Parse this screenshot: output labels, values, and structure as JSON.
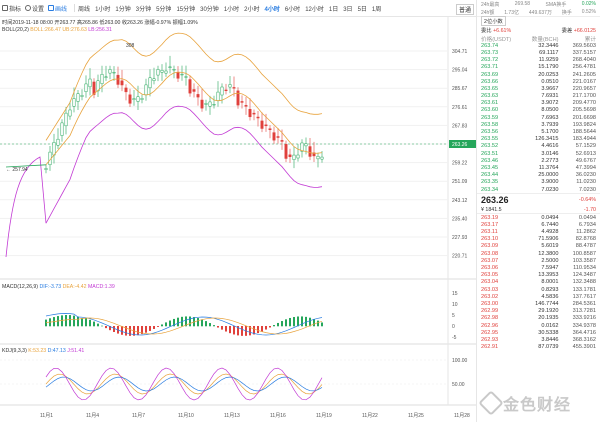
{
  "toolbar": {
    "items": [
      {
        "label": "指标",
        "icon": "indicator-icon"
      },
      {
        "label": "设置",
        "icon": "settings-icon"
      },
      {
        "label": "画线",
        "icon": "draw-line-icon",
        "active": true
      }
    ],
    "periods": [
      "周线",
      "1小时",
      "1分钟",
      "3分钟",
      "5分钟",
      "15分钟",
      "30分钟",
      "1小时",
      "2小时",
      "4小时",
      "6小时",
      "12小时",
      "1日",
      "3日",
      "5日",
      "1周"
    ],
    "active_period_index": 9,
    "right_select": "普通",
    "right_select2": "原生"
  },
  "info_line": {
    "text": "时间2019-11-18 08:00  开263.77  高265.86  低263.00  收263.26  涨幅-0.97%  振幅1.09%"
  },
  "boll_legend": {
    "label": "BOLL(20,2)",
    "boll": "BOLL:266.47",
    "ub": "UB:276.63",
    "lb": "LB:256.31"
  },
  "macd_legend": {
    "label": "MACD(12,26,9)",
    "dif": "DIF:-3.73",
    "dea": "DEA:-4.42",
    "macd": "MACD:1.39"
  },
  "kdj_legend": {
    "label": "KDJ(9,3,3)",
    "k": "K:53.23",
    "d": "D:47.13",
    "j": "J:51.41"
  },
  "annotations": {
    "high_label": "308",
    "low_label": "257.94"
  },
  "price_axis": [
    "304.71",
    "295.04",
    "285.67",
    "276.61",
    "267.83",
    "263.26",
    "259.22",
    "251.09",
    "243.12",
    "235.40",
    "227.93",
    "220.71"
  ],
  "macd_axis": [
    "15",
    "10",
    "5",
    "0",
    "-5"
  ],
  "kdj_axis": [
    "100.00",
    "50.00"
  ],
  "date_axis": [
    "11月1",
    "11月4",
    "11月7",
    "11月10",
    "11月13",
    "11月16",
    "11月19",
    "11月22",
    "11月25",
    "11月28"
  ],
  "colors": {
    "up": "#26a65b",
    "down": "#e0413c",
    "boll_mid": "#e8a33d",
    "boll_up": "#e8a33d",
    "boll_low": "#c23bd4",
    "macd_dif": "#2a7de1",
    "macd_dea": "#e8a33d",
    "k": "#e8a33d",
    "d": "#2a7de1",
    "j": "#c23bd4"
  },
  "side": {
    "header_left": "24h最高",
    "header_left2": "24h最低",
    "header_mid": "269.58",
    "header_right_label": "SMA换手",
    "header_right": "0.02%",
    "amount": "1.73亿",
    "turnover_label": "换手",
    "turnover": "0.52%",
    "vol_label": "24h额",
    "vol": "449.637万",
    "depth_label": "2位小数",
    "wei_bi_label": "委比",
    "wei_bi": "+6.61%",
    "wei_cha_label": "委差",
    "wei_cha": "+66.0125",
    "col_price": "价格(USDT)",
    "col_amount": "数量(BCH)",
    "col_total": "累计",
    "asks": [
      {
        "p": "263.74",
        "a": "32.3446",
        "t": "369.5603"
      },
      {
        "p": "263.73",
        "a": "69.1117",
        "t": "337.5157"
      },
      {
        "p": "263.72",
        "a": "11.9259",
        "t": "268.4040"
      },
      {
        "p": "263.71",
        "a": "15.1790",
        "t": "256.4781"
      },
      {
        "p": "263.69",
        "a": "20.0253",
        "t": "241.2605"
      },
      {
        "p": "263.66",
        "a": "0.0510",
        "t": "221.0167"
      },
      {
        "p": "263.65",
        "a": "3.9667",
        "t": "220.9657"
      },
      {
        "p": "263.63",
        "a": "7.6931",
        "t": "217.1700"
      },
      {
        "p": "263.61",
        "a": "3.9072",
        "t": "209.4770"
      },
      {
        "p": "263.60",
        "a": "8.0500",
        "t": "205.5698"
      },
      {
        "p": "263.59",
        "a": "7.6963",
        "t": "201.6698"
      },
      {
        "p": "263.58",
        "a": "3.7939",
        "t": "193.9824"
      },
      {
        "p": "263.56",
        "a": "5.1700",
        "t": "188.5644"
      },
      {
        "p": "263.55",
        "a": "126.3415",
        "t": "183.4944"
      },
      {
        "p": "263.52",
        "a": "4.4616",
        "t": "57.1529"
      },
      {
        "p": "263.51",
        "a": "3.0146",
        "t": "52.6913"
      },
      {
        "p": "263.46",
        "a": "2.2773",
        "t": "49.6767"
      },
      {
        "p": "263.45",
        "a": "11.3764",
        "t": "47.3994"
      },
      {
        "p": "263.44",
        "a": "25.0000",
        "t": "36.0230"
      },
      {
        "p": "263.35",
        "a": "3.9000",
        "t": "11.0230"
      },
      {
        "p": "263.34",
        "a": "7.0230",
        "t": "7.0230"
      }
    ],
    "last_price": "263.26",
    "last_change": "-0.64%",
    "cny": "¥ 1841.5",
    "cny_change": "-1.70",
    "bids": [
      {
        "p": "263.19",
        "a": "0.0494",
        "t": "0.0494"
      },
      {
        "p": "263.17",
        "a": "6.7440",
        "t": "6.7934"
      },
      {
        "p": "263.11",
        "a": "4.4928",
        "t": "11.2862"
      },
      {
        "p": "263.10",
        "a": "71.5906",
        "t": "82.8768"
      },
      {
        "p": "263.09",
        "a": "5.6019",
        "t": "88.4787"
      },
      {
        "p": "263.08",
        "a": "12.3800",
        "t": "100.8587"
      },
      {
        "p": "263.07",
        "a": "2.5000",
        "t": "103.3587"
      },
      {
        "p": "263.06",
        "a": "7.5947",
        "t": "110.9534"
      },
      {
        "p": "263.05",
        "a": "13.3953",
        "t": "124.3487"
      },
      {
        "p": "263.04",
        "a": "8.0001",
        "t": "132.3488"
      },
      {
        "p": "263.03",
        "a": "0.8293",
        "t": "133.1781"
      },
      {
        "p": "263.02",
        "a": "4.5836",
        "t": "137.7617"
      },
      {
        "p": "263.00",
        "a": "146.7744",
        "t": "284.5361"
      },
      {
        "p": "262.99",
        "a": "29.1920",
        "t": "313.7281"
      },
      {
        "p": "262.98",
        "a": "20.1935",
        "t": "333.9216"
      },
      {
        "p": "262.96",
        "a": "0.0162",
        "t": "334.9378"
      },
      {
        "p": "262.95",
        "a": "30.5338",
        "t": "364.4716"
      },
      {
        "p": "262.93",
        "a": "3.8446",
        "t": "368.3162"
      },
      {
        "p": "262.91",
        "a": "87.0739",
        "t": "455.3901"
      }
    ]
  },
  "watermark": "金色财经"
}
